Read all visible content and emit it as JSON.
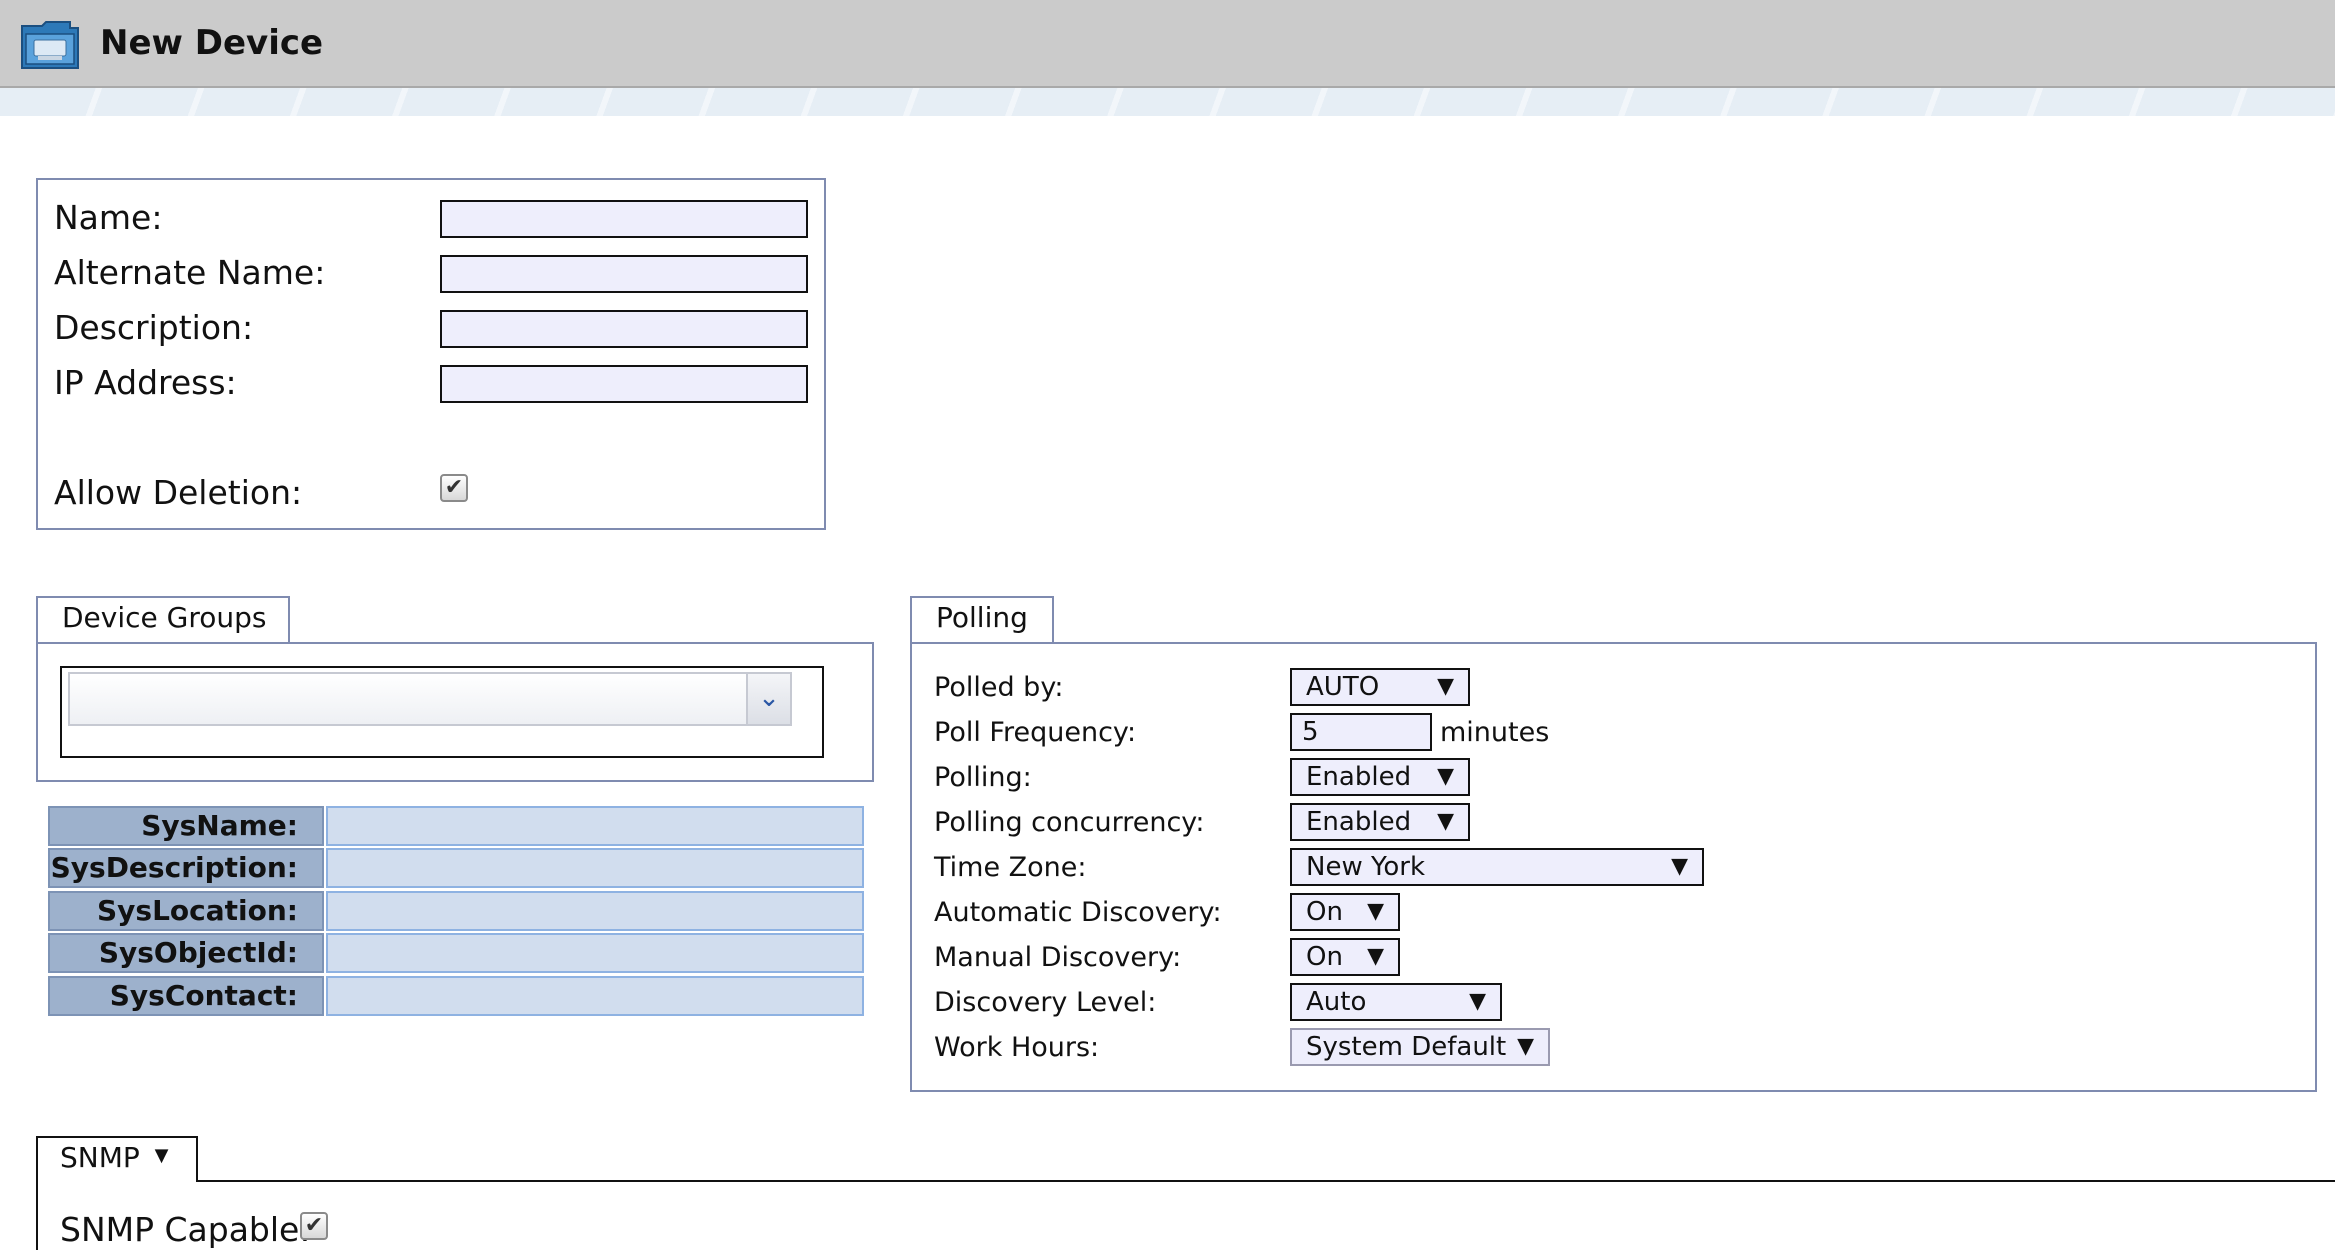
{
  "header": {
    "title": "New Device",
    "icon": "device-folder-icon"
  },
  "basic": {
    "name_label": "Name:",
    "alt_name_label": "Alternate Name:",
    "description_label": "Description:",
    "ip_label": "IP Address:",
    "allow_deletion_label": "Allow Deletion:",
    "name_value": "",
    "alt_name_value": "",
    "description_value": "",
    "ip_value": "",
    "allow_deletion_checked": true,
    "check_glyph": "✔"
  },
  "device_groups": {
    "tab_label": "Device Groups",
    "selected": "",
    "dropdown_glyph": "⌄"
  },
  "sys_info": [
    {
      "label": "SysName:",
      "value": ""
    },
    {
      "label": "SysDescription:",
      "value": ""
    },
    {
      "label": "SysLocation:",
      "value": ""
    },
    {
      "label": "SysObjectId:",
      "value": ""
    },
    {
      "label": "SysContact:",
      "value": ""
    }
  ],
  "polling": {
    "tab_label": "Polling",
    "polled_by": {
      "label": "Polled by:",
      "value": "AUTO"
    },
    "poll_frequency": {
      "label": "Poll Frequency:",
      "value": "5",
      "unit": "minutes"
    },
    "polling": {
      "label": "Polling:",
      "value": "Enabled"
    },
    "concurrency": {
      "label": "Polling concurrency:",
      "value": "Enabled"
    },
    "time_zone": {
      "label": "Time Zone:",
      "value": "New York"
    },
    "auto_discovery": {
      "label": "Automatic Discovery:",
      "value": "On"
    },
    "manual_discovery": {
      "label": "Manual Discovery:",
      "value": "On"
    },
    "discovery_level": {
      "label": "Discovery Level:",
      "value": "Auto"
    },
    "work_hours": {
      "label": "Work Hours:",
      "value": "System Default"
    },
    "arrow_glyph": "▼"
  },
  "snmp": {
    "tab_label": "SNMP",
    "tab_arrow": "▼",
    "capable_label": "SNMP Capable:",
    "capable_checked": true
  }
}
